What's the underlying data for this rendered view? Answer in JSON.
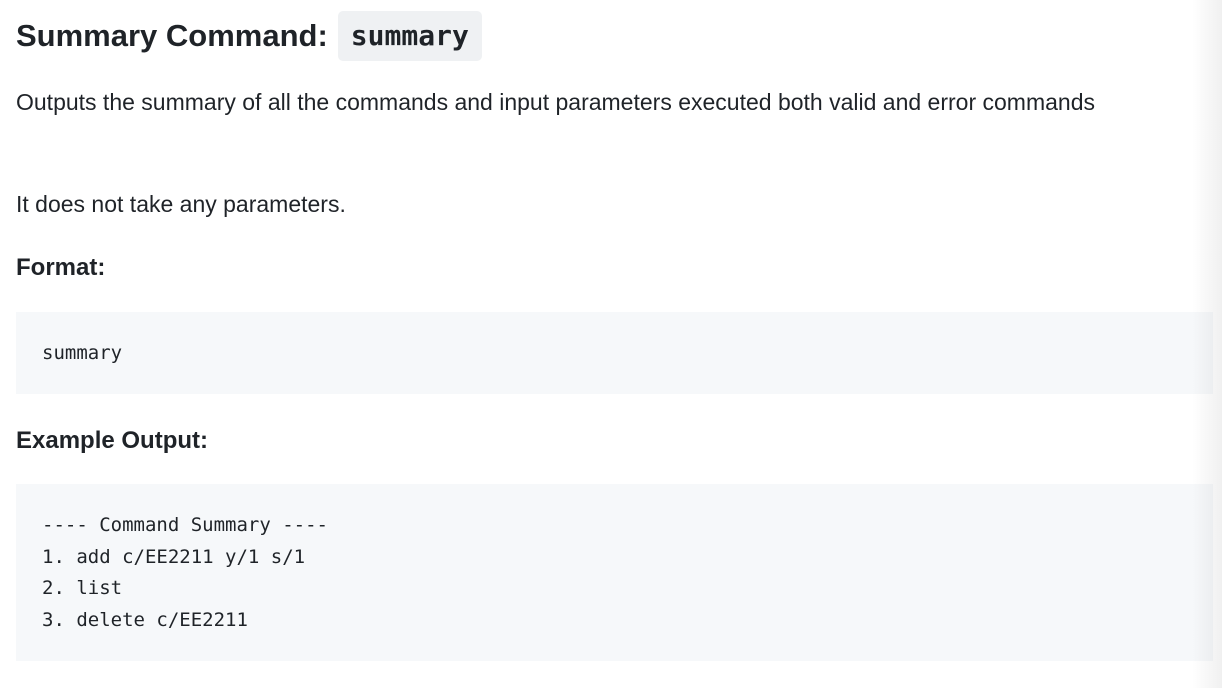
{
  "heading": {
    "text": "Summary Command:",
    "code": "summary"
  },
  "description": "Outputs the summary of all the commands and input parameters executed both valid and error commands",
  "no_params": "It does not take any parameters.",
  "format": {
    "label": "Format:",
    "code": "summary"
  },
  "example_output": {
    "label": "Example Output:",
    "lines": [
      "---- Command Summary ----",
      "1. add c/EE2211 y/1 s/1",
      "2. list",
      "3. delete c/EE2211"
    ]
  }
}
